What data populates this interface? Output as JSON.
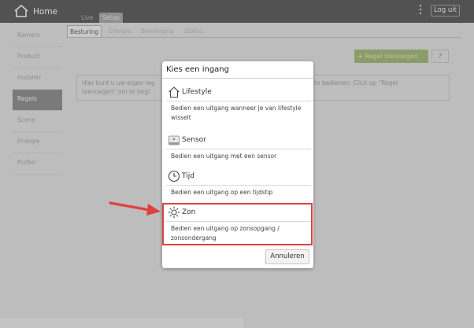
{
  "header": {
    "app_title": "Home",
    "tabs": [
      "Live",
      "Setup"
    ],
    "logout_label": "Log uit"
  },
  "sidebar": {
    "items": [
      "Kamers",
      "Product",
      "Installer",
      "Regels",
      "Scene",
      "Energie",
      "Profiel"
    ]
  },
  "subtabs": [
    "Besturing",
    "Energie",
    "Beveiliging",
    "Status"
  ],
  "content": {
    "add_rule_label": "Regel toevoegen",
    "help_label": "?",
    "info_left": "Hier kunt u uw eigen reg toevoegen\" om te begi",
    "info_right": "te bedienen. Click op \"Regel"
  },
  "modal": {
    "title": "Kies een ingang",
    "options": [
      {
        "icon": "house-icon",
        "name": "Lifestyle",
        "description": "Bedien een uitgang wanneer je van lifestyle wisselt"
      },
      {
        "icon": "sensor-icon",
        "name": "Sensor",
        "description": "Bedien een uitgang met een sensor"
      },
      {
        "icon": "clock-icon",
        "name": "Tijd",
        "description": "Bedien een uitgang op een tijdstip"
      },
      {
        "icon": "sun-icon",
        "name": "Zon",
        "description": "Bedien een uitgang op zonsopgang / zonsondergang"
      }
    ],
    "cancel_label": "Annuleren"
  },
  "colors": {
    "overlay_bg": "#bdbdbd",
    "topbar": "#525252",
    "highlight": "#e04040",
    "arrow": "#e04040",
    "add_button": "#8b9c6a"
  }
}
